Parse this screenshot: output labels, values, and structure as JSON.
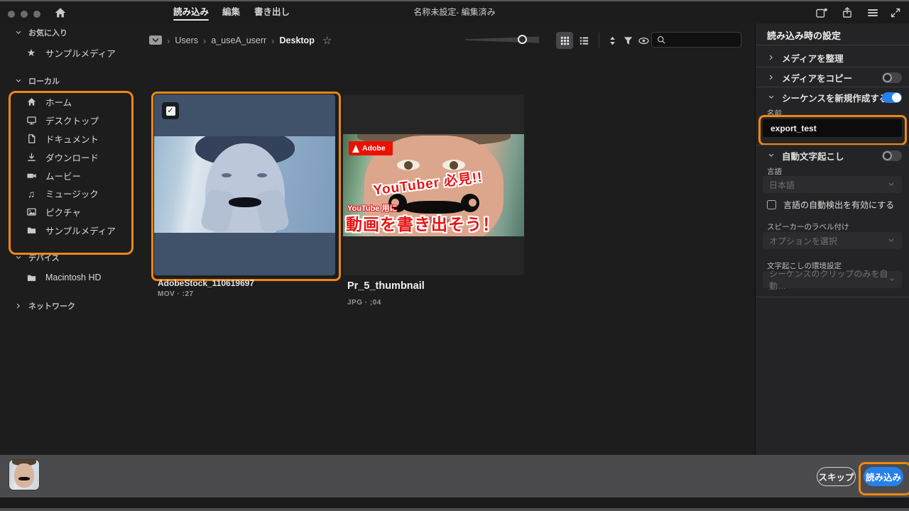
{
  "header": {
    "title": "名称未設定- 編集済み",
    "tabs": [
      {
        "label": "読み込み"
      },
      {
        "label": "編集"
      },
      {
        "label": "書き出し"
      }
    ]
  },
  "sidebar": {
    "sections": [
      {
        "label": "お気に入り"
      },
      {
        "label": "ローカル"
      },
      {
        "label": "デバイス"
      },
      {
        "label": "ネットワーク"
      }
    ],
    "favorites": [
      {
        "icon": "star-icon",
        "label": "サンプルメディア"
      }
    ],
    "local": [
      {
        "icon": "home-icon",
        "label": "ホーム"
      },
      {
        "icon": "monitor-icon",
        "label": "デスクトップ"
      },
      {
        "icon": "document-icon",
        "label": "ドキュメント"
      },
      {
        "icon": "download-icon",
        "label": "ダウンロード"
      },
      {
        "icon": "movie-icon",
        "label": "ムービー"
      },
      {
        "icon": "music-icon",
        "label": "ミュージック"
      },
      {
        "icon": "picture-icon",
        "label": "ピクチャ"
      },
      {
        "icon": "folder-icon",
        "label": "サンプルメディア"
      }
    ],
    "devices": [
      {
        "icon": "folder-icon",
        "label": "Macintosh HD"
      }
    ]
  },
  "breadcrumb": {
    "segments": [
      "Users",
      "a_useA_userr",
      "Desktop"
    ]
  },
  "media": {
    "items": [
      {
        "name": "AdobeStock_110619697",
        "meta": "MOV · :27",
        "selected": true
      },
      {
        "name": "Pr_5_thumbnail",
        "meta": "JPG · ;04",
        "selected": false
      }
    ],
    "thumb2_overlay": {
      "brand": "Adobe",
      "line1": "YouTuber 必見!!",
      "line2": "YouTube 用に",
      "line3": "動画を書き出そう！"
    }
  },
  "panel": {
    "title": "読み込み時の設定",
    "organize_label": "メディアを整理",
    "copy_label": "メディアをコピー",
    "copy_toggle": "off",
    "sequence_label": "シーケンスを新規作成する",
    "sequence_toggle": "on",
    "name_label": "名前",
    "name_value": "export_test",
    "transcribe_label": "自動文字起こし",
    "transcribe_toggle": "off",
    "language_label": "言語",
    "language_value": "日本語",
    "autodetect_label": "言語の自動検出を有効にする",
    "autodetect_checked": false,
    "speaker_label": "スピーカーのラベル付け",
    "speaker_value": "オプションを選択",
    "pref_label": "文字起こしの環境設定",
    "pref_value": "シーケンスのクリップのみを自動…"
  },
  "footer": {
    "skip": "スキップ",
    "import": "読み込み"
  },
  "colors": {
    "accent_orange": "#ED8712",
    "accent_blue": "#2680EB",
    "selection_tint": "#405269"
  }
}
